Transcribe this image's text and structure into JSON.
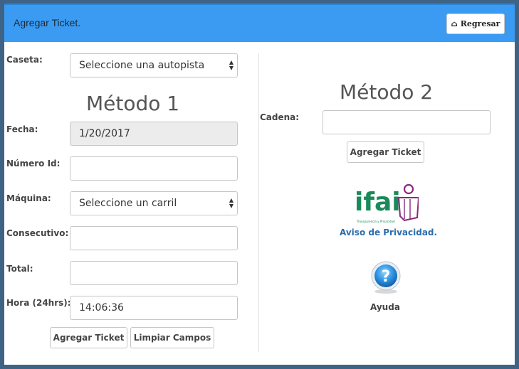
{
  "header": {
    "title": "Agregar Ticket.",
    "back_label": "Regresar",
    "back_icon": "home-icon"
  },
  "method1": {
    "heading": "Método 1",
    "caseta": {
      "label": "Caseta:",
      "selected": "Seleccione una autopista"
    },
    "fecha": {
      "label": "Fecha:",
      "value": "1/20/2017"
    },
    "numero_id": {
      "label": "Número Id:",
      "value": ""
    },
    "maquina": {
      "label": "Máquina:",
      "selected": "Seleccione un carril"
    },
    "consecutivo": {
      "label": "Consecutivo:",
      "value": ""
    },
    "total": {
      "label": "Total:",
      "value": ""
    },
    "hora": {
      "label": "Hora (24hrs):",
      "value": "14:06:36"
    },
    "add_button": "Agregar Ticket",
    "clear_button": "Limpiar Campos"
  },
  "method2": {
    "heading": "Método 2",
    "cadena": {
      "label": "Cadena:",
      "value": ""
    },
    "add_button": "Agregar Ticket"
  },
  "sidebar": {
    "logo_text": "ifai",
    "logo_tagline": "Transparencia y Privacidad",
    "privacy_link": "Aviso de Privacidad.",
    "help_label": "Ayuda"
  },
  "colors": {
    "header_bg": "#3b9bf2",
    "frame": "#3f6385",
    "logo_green": "#1a8a5a",
    "logo_purple": "#8a2a7e",
    "link": "#2b6dad"
  }
}
